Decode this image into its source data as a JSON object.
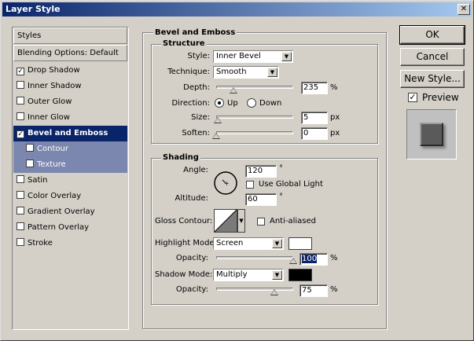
{
  "window": {
    "title": "Layer Style",
    "close_glyph": "✕"
  },
  "styles_panel": {
    "header": "Styles",
    "blending": "Blending Options: Default",
    "items": [
      {
        "label": "Drop Shadow",
        "checked": true
      },
      {
        "label": "Inner Shadow",
        "checked": false
      },
      {
        "label": "Outer Glow",
        "checked": false
      },
      {
        "label": "Inner Glow",
        "checked": false
      },
      {
        "label": "Bevel and Emboss",
        "checked": true,
        "selected": true
      },
      {
        "label": "Contour",
        "checked": false,
        "sub": true
      },
      {
        "label": "Texture",
        "checked": false,
        "sub": true
      },
      {
        "label": "Satin",
        "checked": false
      },
      {
        "label": "Color Overlay",
        "checked": false
      },
      {
        "label": "Gradient Overlay",
        "checked": false
      },
      {
        "label": "Pattern Overlay",
        "checked": false
      },
      {
        "label": "Stroke",
        "checked": false
      }
    ]
  },
  "bevel": {
    "group_title": "Bevel and Emboss",
    "structure": {
      "title": "Structure",
      "style_label": "Style:",
      "style_value": "Inner Bevel",
      "technique_label": "Technique:",
      "technique_value": "Smooth",
      "depth_label": "Depth:",
      "depth_value": "235",
      "depth_unit": "%",
      "depth_level": 0.22,
      "direction_label": "Direction:",
      "direction_up": "Up",
      "direction_down": "Down",
      "size_label": "Size:",
      "size_value": "5",
      "size_unit": "px",
      "size_level": 0.02,
      "soften_label": "Soften:",
      "soften_value": "0",
      "soften_unit": "px",
      "soften_level": 0.0
    },
    "shading": {
      "title": "Shading",
      "angle_label": "Angle:",
      "angle_value": "120",
      "angle_unit": "°",
      "use_global_light": "Use Global Light",
      "altitude_label": "Altitude:",
      "altitude_value": "60",
      "altitude_unit": "°",
      "gloss_contour_label": "Gloss Contour:",
      "anti_aliased": "Anti-aliased",
      "highlight_mode_label": "Highlight Mode:",
      "highlight_mode_value": "Screen",
      "highlight_color": "#ffffff",
      "highlight_opacity_label": "Opacity:",
      "highlight_opacity_value": "100",
      "highlight_opacity_unit": "%",
      "highlight_opacity_level": 1.0,
      "shadow_mode_label": "Shadow Mode:",
      "shadow_mode_value": "Multiply",
      "shadow_color": "#000000",
      "shadow_opacity_label": "Opacity:",
      "shadow_opacity_value": "75",
      "shadow_opacity_unit": "%",
      "shadow_opacity_level": 0.75
    }
  },
  "buttons": {
    "ok": "OK",
    "cancel": "Cancel",
    "new_style": "New Style...",
    "preview": "Preview",
    "preview_checked": true
  }
}
